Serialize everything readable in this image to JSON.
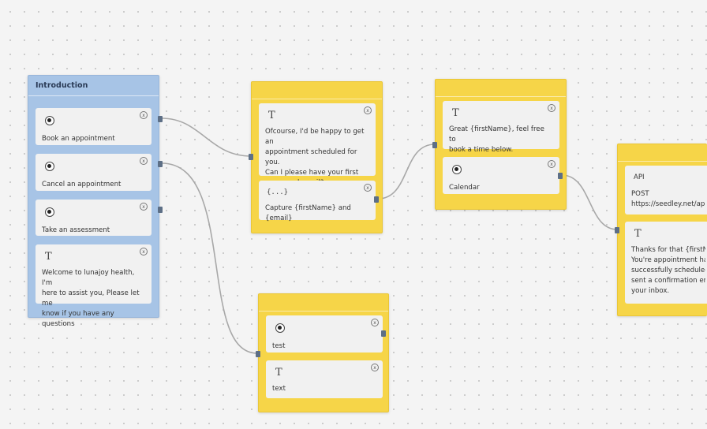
{
  "colors": {
    "intro_node": "#a7c4e6",
    "step_node": "#f6d548",
    "canvas": "#f4f4f4"
  },
  "close_glyph": "x",
  "nodes": {
    "introduction": {
      "title": "Introduction",
      "steps": [
        {
          "icon": "radio-icon",
          "text": "Book an appointment"
        },
        {
          "icon": "radio-icon",
          "text": "Cancel an appointment"
        },
        {
          "icon": "radio-icon",
          "text": "Take an assessment"
        },
        {
          "icon": "text-icon",
          "icon_glyph": "T",
          "text": "Welcome to lunajoy health, I'm\nhere to assist you, Please let me\nknow if you have any questions"
        }
      ]
    },
    "capture": {
      "steps": [
        {
          "icon": "text-icon",
          "icon_glyph": "T",
          "text": "Ofcourse, I'd be happy to get an\nappointment scheduled for you.\nCan I please have your first\nname and email?"
        },
        {
          "icon": "braces-icon",
          "icon_glyph": "{...}",
          "text": "Capture {firstName} and {email}"
        }
      ]
    },
    "booking": {
      "steps": [
        {
          "icon": "text-icon",
          "icon_glyph": "T",
          "text": "Great {firstName}, feel free to\nbook a time below."
        },
        {
          "icon": "radio-icon",
          "text": "Calendar"
        }
      ]
    },
    "confirmation": {
      "steps": [
        {
          "icon": "api-icon",
          "label": "API",
          "text": "POST\nhttps://seedley.net/api/"
        },
        {
          "icon": "text-icon",
          "icon_glyph": "T",
          "text": "Thanks for that {firstNa\nYou're appointment has\nsuccessfully scheduled.\nsent a confirmation ema\nyour inbox."
        }
      ]
    },
    "test": {
      "steps": [
        {
          "icon": "radio-icon",
          "text": "test"
        },
        {
          "icon": "text-icon",
          "icon_glyph": "T",
          "text": "text"
        }
      ]
    }
  }
}
